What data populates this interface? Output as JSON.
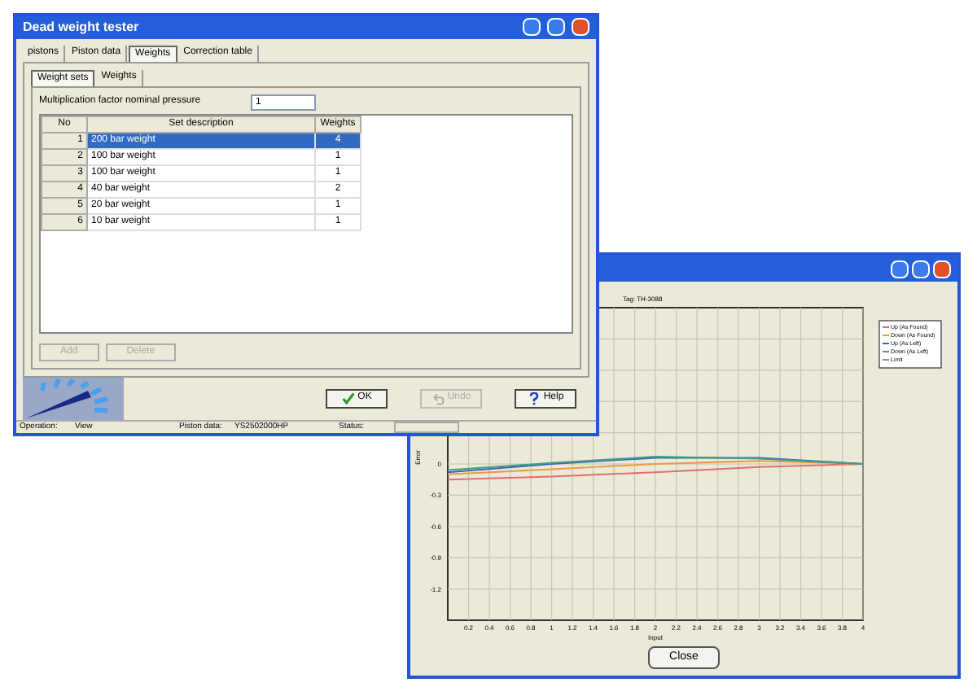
{
  "dialog": {
    "title": "Dead weight tester",
    "tabs": [
      {
        "label": "pistons",
        "selected": false
      },
      {
        "label": "Piston data",
        "selected": false
      },
      {
        "label": "Weights",
        "selected": true
      },
      {
        "label": "Correction table",
        "selected": false
      }
    ],
    "subtabs": [
      {
        "label": "Weight sets",
        "selected": true
      },
      {
        "label": "Weights",
        "selected": false
      }
    ],
    "factor": {
      "label": "Multiplication factor nominal pressure",
      "value": "1"
    },
    "table": {
      "columns": [
        "No",
        "Set description",
        "Weights"
      ],
      "rows": [
        {
          "no": "1",
          "description": "200 bar weight",
          "weights": "4",
          "selected": true
        },
        {
          "no": "2",
          "description": "100 bar weight",
          "weights": "1",
          "selected": false
        },
        {
          "no": "3",
          "description": "100 bar weight",
          "weights": "1",
          "selected": false
        },
        {
          "no": "4",
          "description": "40 bar weight",
          "weights": "2",
          "selected": false
        },
        {
          "no": "5",
          "description": "20 bar weight",
          "weights": "1",
          "selected": false
        },
        {
          "no": "6",
          "description": "10 bar weight",
          "weights": "1",
          "selected": false
        }
      ]
    },
    "list_buttons": [
      {
        "label": "Add",
        "disabled": true
      },
      {
        "label": "Delete",
        "disabled": true
      }
    ],
    "buttons": [
      {
        "label": "OK",
        "kind": "ok",
        "disabled": false
      },
      {
        "label": "Undo",
        "kind": "undo",
        "disabled": true
      },
      {
        "label": "Help",
        "kind": "help",
        "disabled": false
      }
    ],
    "status_bar": [
      {
        "label": "Operation:",
        "value": "View"
      },
      {
        "label": "Piston data:",
        "value": "YS2502000HP"
      },
      {
        "label": "Status:"
      }
    ]
  },
  "chart_window": {
    "close_button": "Close",
    "chart_data": {
      "type": "line",
      "title": "Tag: TH-3088",
      "xlabel": "Input",
      "ylabel": "Error",
      "x": [
        0,
        1,
        2,
        3,
        4
      ],
      "series": [
        {
          "name": "Up (As Found)",
          "color": "#e07070",
          "values": [
            -0.15,
            -0.12,
            -0.08,
            -0.03,
            0
          ]
        },
        {
          "name": "Down (As Found)",
          "color": "#e0a040",
          "values": [
            -0.1,
            -0.05,
            0,
            0.03,
            0
          ]
        },
        {
          "name": "Up (As Left)",
          "color": "#4060c0",
          "values": [
            -0.08,
            0,
            0.06,
            0.06,
            0
          ]
        },
        {
          "name": "Down (As Left)",
          "color": "#40a080",
          "values": [
            -0.06,
            0.01,
            0.07,
            0.05,
            0
          ]
        },
        {
          "name": "Limit",
          "color": "#909090",
          "values": [
            null,
            null,
            null,
            null,
            null
          ]
        }
      ],
      "xlim": [
        0,
        4
      ],
      "ylim": [
        -1.5,
        1.5
      ],
      "xticks": [
        0.2,
        0.4,
        0.6,
        0.8,
        1,
        1.2,
        1.4,
        1.6,
        1.8,
        2,
        2.2,
        2.4,
        2.6,
        2.8,
        3,
        3.2,
        3.4,
        3.6,
        3.8,
        4
      ],
      "yticks": [
        0,
        -0.3,
        -0.6,
        -0.9,
        -1.2
      ],
      "grid": true,
      "legend": true
    }
  }
}
